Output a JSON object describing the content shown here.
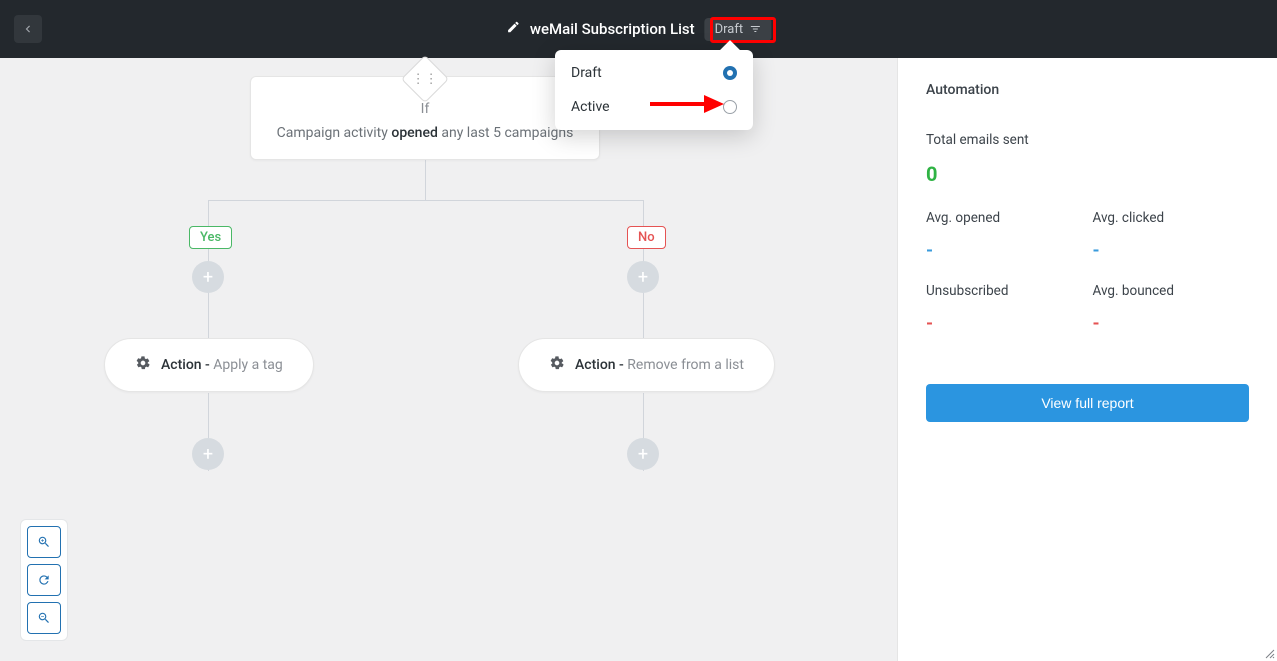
{
  "header": {
    "title": "weMail Subscription List",
    "status_chip": "Draft"
  },
  "status_menu": {
    "draft": "Draft",
    "active": "Active",
    "selected": "draft"
  },
  "flow": {
    "condition": {
      "if_label": "If",
      "line_prefix": "Campaign activity",
      "line_bold": "opened",
      "line_suffix": "any last 5 campaigns"
    },
    "branch_yes": "Yes",
    "branch_no": "No",
    "action_yes": {
      "prefix": "Action -",
      "detail": "Apply a tag"
    },
    "action_no": {
      "prefix": "Action -",
      "detail": "Remove from a list"
    }
  },
  "sidebar": {
    "heading": "Automation",
    "total_label": "Total emails sent",
    "total_value": "0",
    "metrics": {
      "avg_opened_label": "Avg. opened",
      "avg_opened_value": "-",
      "avg_clicked_label": "Avg. clicked",
      "avg_clicked_value": "-",
      "unsubscribed_label": "Unsubscribed",
      "unsubscribed_value": "-",
      "avg_bounced_label": "Avg. bounced",
      "avg_bounced_value": "-"
    },
    "report_button": "View full report"
  }
}
